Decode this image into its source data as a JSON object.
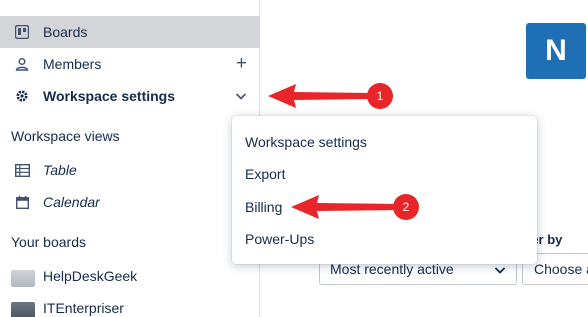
{
  "sidebar": {
    "items": {
      "boards": {
        "label": "Boards",
        "icon": "board-icon"
      },
      "members": {
        "label": "Members",
        "icon": "person-icon",
        "action": "+"
      },
      "workspace_settings": {
        "label": "Workspace settings",
        "icon": "gear-icon"
      }
    },
    "workspace_views": {
      "heading": "Workspace views",
      "items": [
        {
          "label": "Table",
          "icon": "table-icon"
        },
        {
          "label": "Calendar",
          "icon": "calendar-icon"
        }
      ]
    },
    "your_boards": {
      "heading": "Your boards",
      "items": [
        {
          "label": "HelpDeskGeek"
        },
        {
          "label": "ITEnterpriser"
        }
      ]
    }
  },
  "workspace_logo": {
    "letter": "N",
    "color": "#1f6fb5"
  },
  "filters": {
    "filter_label": "ter by",
    "sort_value": "Most recently active",
    "filter_value": "Choose a"
  },
  "dropdown_menu": {
    "items": [
      "Workspace settings",
      "Export",
      "Billing",
      "Power-Ups"
    ]
  },
  "annotations": {
    "arrow_color": "#e8262a",
    "badges": [
      "1",
      "2"
    ]
  }
}
